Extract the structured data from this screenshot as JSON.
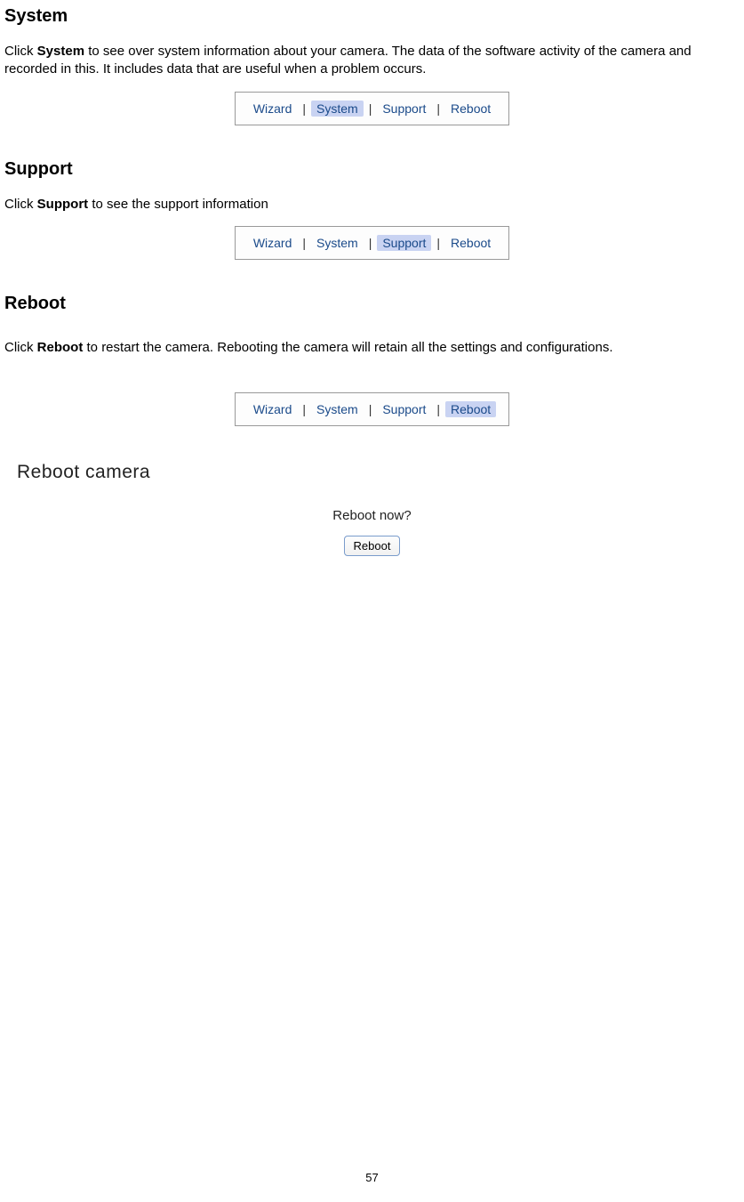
{
  "sections": {
    "system": {
      "heading": "System",
      "para_pre": "Click ",
      "para_bold": "System",
      "para_post": " to see over system information about your camera. The data of the software activity of the camera and recorded in this. It includes data that are useful when a problem occurs."
    },
    "support": {
      "heading": "Support",
      "para_pre": "Click ",
      "para_bold": "Support",
      "para_post": " to see the support information"
    },
    "reboot": {
      "heading": "Reboot",
      "para_pre": "Click ",
      "para_bold": "Reboot",
      "para_post": " to restart the camera. Rebooting the camera will retain all the settings and configurations."
    }
  },
  "tabbar": {
    "wizard": "Wizard",
    "system": "System",
    "support": "Support",
    "reboot": "Reboot",
    "separator": "|"
  },
  "reboot_panel": {
    "title": "Reboot camera",
    "prompt": "Reboot now?",
    "button": "Reboot"
  },
  "page_number": "57"
}
